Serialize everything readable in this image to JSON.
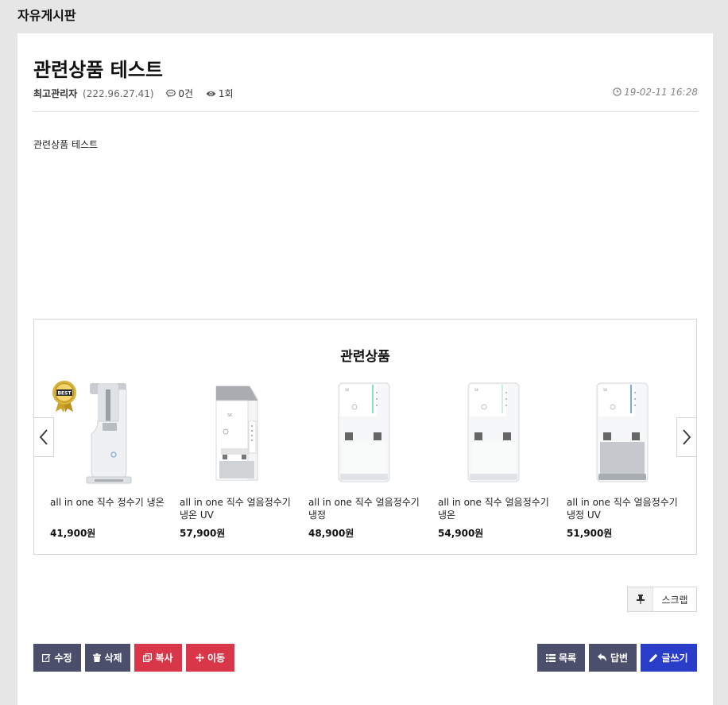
{
  "board": {
    "title": "자유게시판"
  },
  "post": {
    "title": "관련상품 테스트",
    "author": "최고관리자",
    "ip": "(222.96.27.41)",
    "comments": "0건",
    "views": "1회",
    "date": "19-02-11 16:28",
    "content": "관련상품 테스트"
  },
  "related": {
    "title": "관련상품",
    "products": [
      {
        "name": "all in one 직수 정수기 냉온",
        "price": "41,900원",
        "badge": "BEST"
      },
      {
        "name": "all in one 직수 얼음정수기 냉온 UV",
        "price": "57,900원"
      },
      {
        "name": "all in one 직수 얼음정수기 냉정",
        "price": "48,900원"
      },
      {
        "name": "all in one 직수 얼음정수기 냉온",
        "price": "54,900원"
      },
      {
        "name": "all in one 직수 얼음정수기 냉정 UV",
        "price": "51,900원"
      }
    ]
  },
  "actions": {
    "scrap": "스크랩",
    "edit": "수정",
    "delete": "삭제",
    "copy": "복사",
    "move": "이동",
    "list": "목록",
    "reply": "답변",
    "write": "글쓰기"
  },
  "colors": {
    "dark_button": "#4b4f6b",
    "red_button": "#d9364a",
    "blue_button": "#2a3dc8",
    "background": "#e6e6e6"
  }
}
